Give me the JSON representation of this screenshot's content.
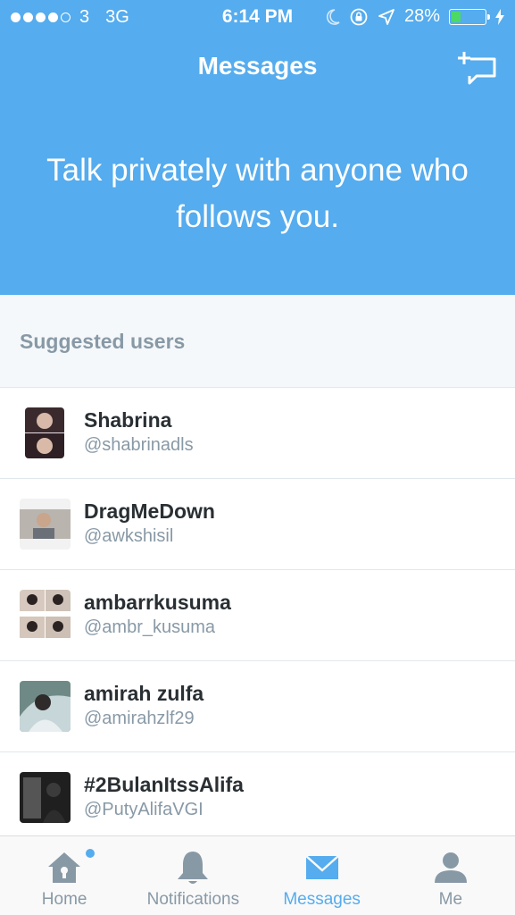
{
  "status_bar": {
    "carrier": "3",
    "network": "3G",
    "time": "6:14 PM",
    "battery": "28%",
    "battery_level": 0.28,
    "signal_bars": 4
  },
  "header": {
    "title": "Messages",
    "compose_icon": "compose-message-icon",
    "tagline": "Talk privately with anyone who follows you."
  },
  "suggested": {
    "title": "Suggested users",
    "users": [
      {
        "name": "Shabrina",
        "handle": "@shabrinadls"
      },
      {
        "name": "DragMeDown",
        "handle": "@awkshisil"
      },
      {
        "name": "ambarrkusuma",
        "handle": "@ambr_kusuma"
      },
      {
        "name": "amirah zulfa",
        "handle": "@amirahzlf29"
      },
      {
        "name": "#2BulanItssAlifa",
        "handle": "@PutyAlifaVGI"
      }
    ]
  },
  "tabs": [
    {
      "label": "Home",
      "icon": "home-icon",
      "has_badge": true
    },
    {
      "label": "Notifications",
      "icon": "bell-icon"
    },
    {
      "label": "Messages",
      "icon": "envelope-icon",
      "active": true
    },
    {
      "label": "Me",
      "icon": "person-icon"
    }
  ],
  "colors": {
    "brand": "#55acee",
    "battery_fill": "#4cd964",
    "secondary_text": "#8899a6",
    "primary_text": "#292f33"
  }
}
